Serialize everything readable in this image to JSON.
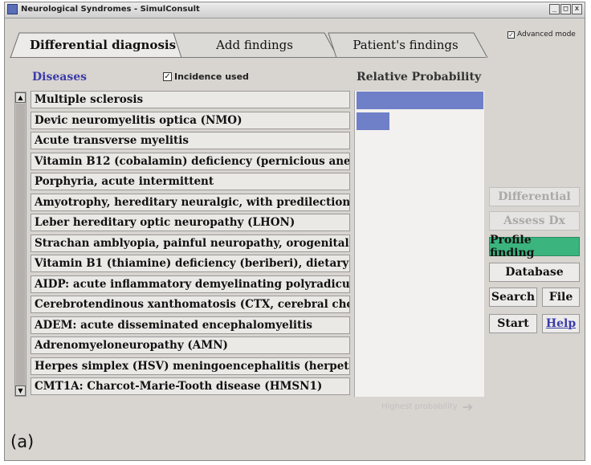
{
  "window": {
    "title": "Neurological Syndromes - SimulConsult",
    "controls": [
      "_",
      "□",
      "x"
    ]
  },
  "tabs": [
    {
      "label": "Differential diagnosis",
      "active": true
    },
    {
      "label": "Add findings",
      "active": false
    },
    {
      "label": "Patient's findings",
      "active": false
    }
  ],
  "advanced_mode": {
    "label": "Advanced mode",
    "checked": true
  },
  "diseases_header": "Diseases",
  "incidence": {
    "label": "Incidence used",
    "checked": true
  },
  "relative_probability_header": "Relative Probability",
  "diseases": [
    {
      "name": "Multiple sclerosis",
      "probability": 1.0
    },
    {
      "name": "Devic neuromyelitis optica (NMO)",
      "probability": 0.26
    },
    {
      "name": "Acute transverse myelitis",
      "probability": 0
    },
    {
      "name": "Vitamin B12 (cobalamin) deficiency (pernicious anem",
      "probability": 0
    },
    {
      "name": "Porphyria, acute intermittent",
      "probability": 0
    },
    {
      "name": "Amyotrophy, hereditary neuralgic, with predilection f",
      "probability": 0
    },
    {
      "name": "Leber hereditary optic neuropathy (LHON)",
      "probability": 0
    },
    {
      "name": "Strachan amblyopia, painful neuropathy, orogenital d",
      "probability": 0
    },
    {
      "name": "Vitamin B1 (thiamine) deficiency (beriberi), dietary",
      "probability": 0
    },
    {
      "name": "AIDP: acute inflammatory demyelinating polyradicul",
      "probability": 0
    },
    {
      "name": "Cerebrotendinous xanthomatosis (CTX, cerebral cho",
      "probability": 0
    },
    {
      "name": "ADEM: acute disseminated encephalomyelitis",
      "probability": 0
    },
    {
      "name": "Adrenomyeloneuropathy (AMN)",
      "probability": 0
    },
    {
      "name": "Herpes simplex (HSV) meningoencephalitis (herpetic",
      "probability": 0
    },
    {
      "name": "CMT1A: Charcot-Marie-Tooth disease (HMSN1)",
      "probability": 0
    }
  ],
  "hint": {
    "text": "Highest probability",
    "arrow": "➔"
  },
  "buttons": {
    "differential": "Differential",
    "assess_dx": "Assess Dx",
    "profile_finding": "Profile finding",
    "database": "Database",
    "search": "Search",
    "file": "File",
    "start": "Start",
    "help": "Help"
  },
  "caption": "(a)",
  "colors": {
    "bar": "#6f80c8",
    "profile_finding": "#3bb47e",
    "diseases_header": "#3a3aa8"
  }
}
